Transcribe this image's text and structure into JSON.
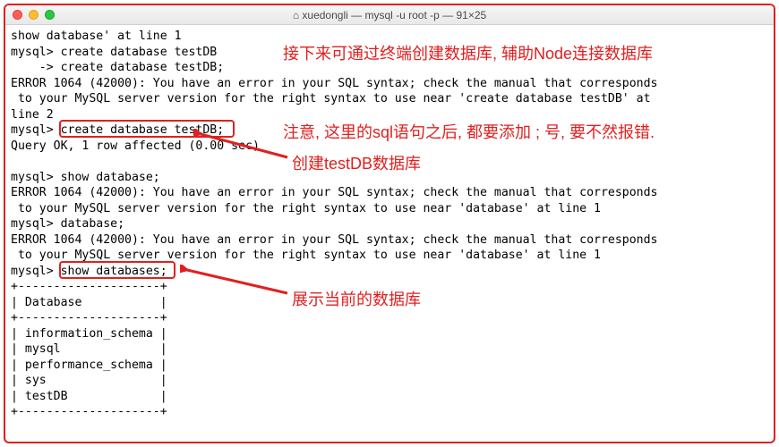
{
  "window": {
    "title": "xuedongli — mysql -u root -p — 91×25",
    "homeIcon": "⌂"
  },
  "terminal": {
    "lines": [
      "show database' at line 1",
      "mysql> create database testDB",
      "    -> create database testDB;",
      "ERROR 1064 (42000): You have an error in your SQL syntax; check the manual that corresponds",
      " to your MySQL server version for the right syntax to use near 'create database testDB' at ",
      "line 2",
      "mysql> create database testDB;",
      "Query OK, 1 row affected (0.00 sec)",
      "",
      "mysql> show database;",
      "ERROR 1064 (42000): You have an error in your SQL syntax; check the manual that corresponds",
      " to your MySQL server version for the right syntax to use near 'database' at line 1",
      "mysql> database;",
      "ERROR 1064 (42000): You have an error in your SQL syntax; check the manual that corresponds",
      " to your MySQL server version for the right syntax to use near 'database' at line 1",
      "mysql> show databases;",
      "+--------------------+",
      "| Database           |",
      "+--------------------+",
      "| information_schema |",
      "| mysql              |",
      "| performance_schema |",
      "| sys                |",
      "| testDB             |",
      "+--------------------+"
    ]
  },
  "annotations": {
    "top": "接下来可通过终端创建数据库, 辅助Node连接数据库",
    "note": "注意, 这里的sql语句之后, 都要添加 ; 号, 要不然报错.",
    "create": "创建testDB数据库",
    "show": "展示当前的数据库"
  }
}
